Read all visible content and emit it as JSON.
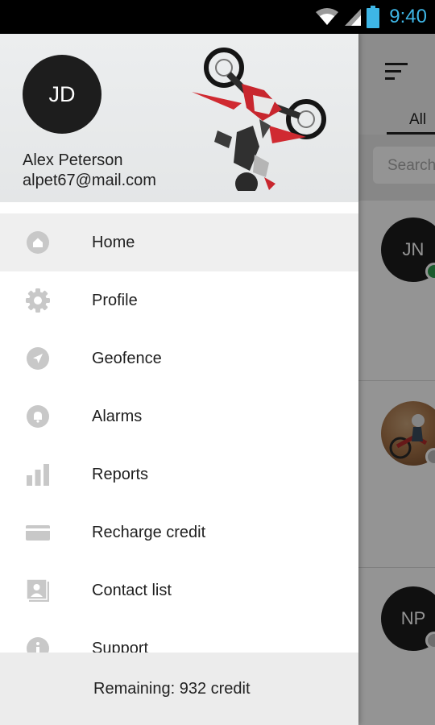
{
  "status_bar": {
    "time": "9:40",
    "icons": [
      "wifi-icon",
      "signal-icon",
      "battery-icon"
    ],
    "time_color": "#3eb6e6"
  },
  "background_app": {
    "tab_label": "All",
    "search_placeholder": "Search",
    "contacts": [
      {
        "initials": "JN",
        "status_color": "#2e9e4f"
      },
      {
        "initials": "",
        "photo": true,
        "status_color": "#bdbdbd"
      },
      {
        "initials": "NP",
        "status_color": "#bdbdbd"
      }
    ]
  },
  "drawer": {
    "header": {
      "avatar_initials": "JD",
      "user_name": "Alex Peterson",
      "user_email": "alpet67@mail.com"
    },
    "menu": [
      {
        "label": "Home",
        "icon": "home-icon",
        "active": true
      },
      {
        "label": "Profile",
        "icon": "gear-icon",
        "active": false
      },
      {
        "label": "Geofence",
        "icon": "navigation-icon",
        "active": false
      },
      {
        "label": "Alarms",
        "icon": "bell-icon",
        "active": false
      },
      {
        "label": "Reports",
        "icon": "bar-chart-icon",
        "active": false
      },
      {
        "label": "Recharge credit",
        "icon": "credit-card-icon",
        "active": false
      },
      {
        "label": "Contact list",
        "icon": "contacts-icon",
        "active": false
      },
      {
        "label": "Support",
        "icon": "info-icon",
        "active": false
      }
    ],
    "footer": {
      "credit_text": "Remaining:  932 credit"
    },
    "icon_color": "#c8c8c8"
  }
}
